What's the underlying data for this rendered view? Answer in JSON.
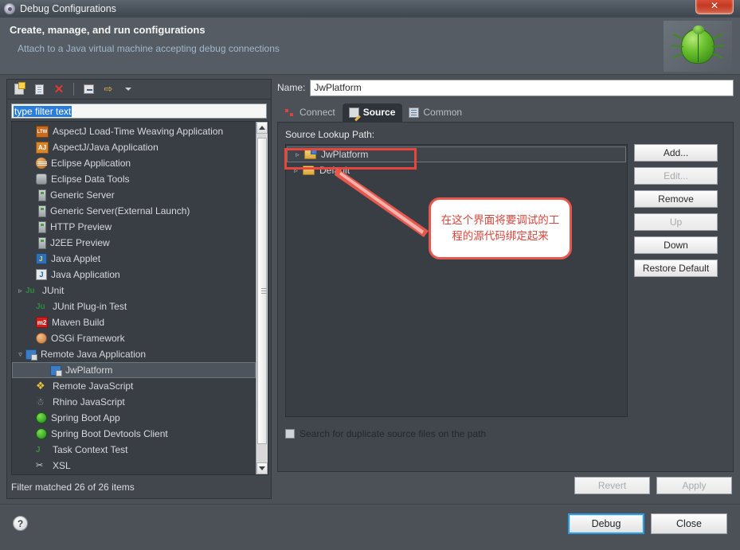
{
  "window": {
    "title": "Debug Configurations",
    "app_icon": "gear-icon",
    "close_label": "✕"
  },
  "header": {
    "title": "Create, manage, and run configurations",
    "subtitle": "Attach to a Java virtual machine accepting debug connections",
    "decor_icon": "green-bug-icon"
  },
  "left_panel": {
    "toolbar": [
      {
        "name": "new-configuration",
        "icon": "new-document-icon"
      },
      {
        "name": "duplicate-configuration",
        "icon": "copy-icon"
      },
      {
        "name": "delete-configuration",
        "icon": "red-x-icon"
      },
      {
        "name": "collapse-all",
        "icon": "collapse-all-icon"
      },
      {
        "name": "filter-configurations",
        "icon": "yellow-arrow-icon"
      },
      {
        "name": "filter-dropdown",
        "icon": "chevron-down-icon"
      }
    ],
    "filter": {
      "value": "type filter text",
      "placeholder": "type filter text"
    },
    "tree": [
      {
        "label": "AspectJ Load-Time Weaving Application",
        "icon": "ltw-icon",
        "twisty": "",
        "indent": 1,
        "selected": false
      },
      {
        "label": "AspectJ/Java Application",
        "icon": "aspectj-icon",
        "twisty": "",
        "indent": 1,
        "selected": false
      },
      {
        "label": "Eclipse Application",
        "icon": "eclipse-icon",
        "twisty": "",
        "indent": 1,
        "selected": false
      },
      {
        "label": "Eclipse Data Tools",
        "icon": "database-icon",
        "twisty": "",
        "indent": 1,
        "selected": false
      },
      {
        "label": "Generic Server",
        "icon": "server-icon",
        "twisty": "",
        "indent": 1,
        "selected": false
      },
      {
        "label": "Generic Server(External Launch)",
        "icon": "server-icon",
        "twisty": "",
        "indent": 1,
        "selected": false
      },
      {
        "label": "HTTP Preview",
        "icon": "server-icon",
        "twisty": "",
        "indent": 1,
        "selected": false
      },
      {
        "label": "J2EE Preview",
        "icon": "server-icon",
        "twisty": "",
        "indent": 1,
        "selected": false
      },
      {
        "label": "Java Applet",
        "icon": "java-applet-icon",
        "twisty": "",
        "indent": 1,
        "selected": false
      },
      {
        "label": "Java Application",
        "icon": "java-application-icon",
        "twisty": "",
        "indent": 1,
        "selected": false
      },
      {
        "label": "JUnit",
        "icon": "junit-icon",
        "twisty": "▹",
        "indent": 0,
        "selected": false
      },
      {
        "label": "JUnit Plug-in Test",
        "icon": "junit-icon",
        "twisty": "",
        "indent": 1,
        "selected": false
      },
      {
        "label": "Maven Build",
        "icon": "maven-icon",
        "twisty": "",
        "indent": 1,
        "selected": false
      },
      {
        "label": "OSGi Framework",
        "icon": "osgi-icon",
        "twisty": "",
        "indent": 1,
        "selected": false
      },
      {
        "label": "Remote Java Application",
        "icon": "remote-java-icon",
        "twisty": "▿",
        "indent": 0,
        "selected": false
      },
      {
        "label": "JwPlatform",
        "icon": "remote-java-icon",
        "twisty": "",
        "indent": 2,
        "selected": true
      },
      {
        "label": "Remote JavaScript",
        "icon": "remote-javascript-icon",
        "twisty": "",
        "indent": 1,
        "selected": false
      },
      {
        "label": "Rhino JavaScript",
        "icon": "rhino-icon",
        "twisty": "",
        "indent": 1,
        "selected": false
      },
      {
        "label": "Spring Boot App",
        "icon": "spring-icon",
        "twisty": "",
        "indent": 1,
        "selected": false
      },
      {
        "label": "Spring Boot Devtools Client",
        "icon": "spring-icon",
        "twisty": "",
        "indent": 1,
        "selected": false
      },
      {
        "label": "Task Context Test",
        "icon": "task-context-icon",
        "twisty": "",
        "indent": 1,
        "selected": false
      },
      {
        "label": "XSL",
        "icon": "xsl-icon",
        "twisty": "",
        "indent": 1,
        "selected": false
      }
    ],
    "status": "Filter matched 26 of 26 items",
    "scrollbar": {
      "up": "▲",
      "down": "▼"
    }
  },
  "right_panel": {
    "name_label": "Name:",
    "name_value": "JwPlatform",
    "tabs": [
      {
        "label": "Connect",
        "icon": "connect-icon",
        "active": false
      },
      {
        "label": "Source",
        "icon": "source-icon",
        "active": true
      },
      {
        "label": "Common",
        "icon": "common-icon",
        "active": false
      }
    ],
    "source_lookup_label": "Source Lookup Path:",
    "source_rows": [
      {
        "label": "JwPlatform",
        "icon": "source-folder-icon",
        "twisty": "▹",
        "highlighted": true
      },
      {
        "label": "Default",
        "icon": "folder-icon",
        "twisty": "▹",
        "highlighted": false
      }
    ],
    "side_buttons": [
      {
        "label": "Add...",
        "enabled": true
      },
      {
        "label": "Edit...",
        "enabled": false
      },
      {
        "label": "Remove",
        "enabled": true
      },
      {
        "label": "Up",
        "enabled": false
      },
      {
        "label": "Down",
        "enabled": true
      },
      {
        "label": "Restore Default",
        "enabled": true
      }
    ],
    "checkbox": {
      "label": "Search for duplicate source files on the path",
      "checked": false
    },
    "revert_label": "Revert",
    "apply_label": "Apply",
    "revert_enabled": false,
    "apply_enabled": false
  },
  "annotation": {
    "callout_text": "在这个界面将要调试的工程的源代码绑定起来",
    "color": "#e8453c"
  },
  "footer": {
    "help_label": "?",
    "debug_label": "Debug",
    "close_label": "Close"
  }
}
